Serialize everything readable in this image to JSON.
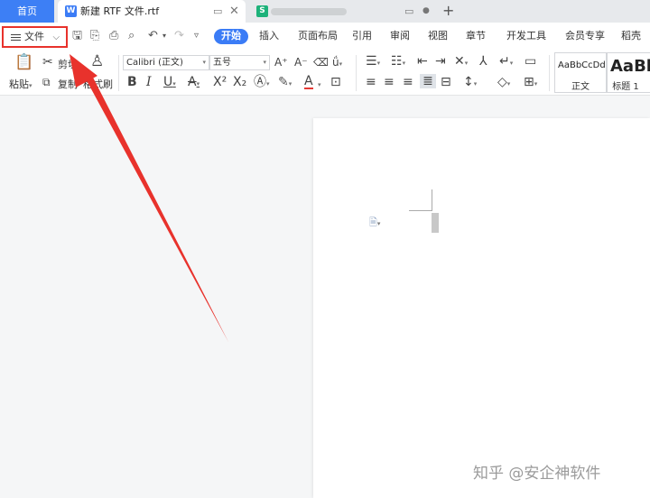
{
  "tabs": {
    "home_label": "首页",
    "doc_title": "新建 RTF 文件.rtf",
    "doc_icon_letter": "W",
    "sheet_icon_letter": "S",
    "add_symbol": "+"
  },
  "menubar": {
    "file_label": "文件",
    "file_chevron": "⌵",
    "tabs": [
      "开始",
      "插入",
      "页面布局",
      "引用",
      "审阅",
      "视图",
      "章节",
      "开发工具",
      "会员专享",
      "稻壳资源"
    ]
  },
  "ribbon": {
    "paste_label": "粘贴",
    "cut_label": "剪切",
    "copy_label": "复制",
    "format_painter_label": "格式刷",
    "font_name": "Calibri (正文)",
    "font_size": "五号",
    "styles": [
      {
        "sample": "AaBbCcDd",
        "name": "正文"
      },
      {
        "sample": "AaBb",
        "name": "标题 1"
      }
    ]
  },
  "watermark": "知乎 @安企神软件",
  "colors": {
    "accent": "#3b7cf6",
    "home_tab": "#3d7ff5",
    "highlight_border": "#e8322c",
    "annotation_arrow": "#e8322c",
    "sheet_icon": "#1db27a"
  },
  "icons": [
    "hamburger-menu-icon",
    "save-icon",
    "export-pdf-icon",
    "print-icon",
    "print-preview-icon",
    "undo-icon",
    "redo-icon",
    "paste-icon",
    "cut-icon",
    "copy-icon",
    "format-painter-icon"
  ]
}
